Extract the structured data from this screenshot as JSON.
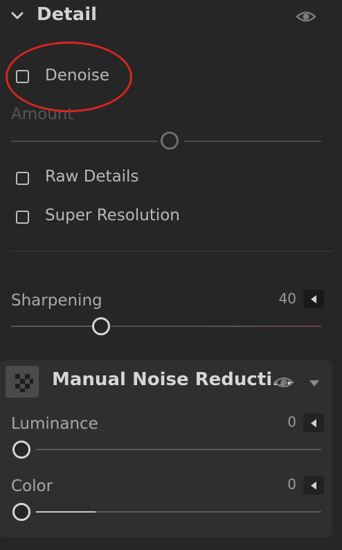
{
  "detail": {
    "title": "Detail",
    "chevron_icon": "chevron-down-icon",
    "visibility_icon": "eye-icon",
    "checkboxes": [
      {
        "label": "Denoise",
        "checked": false
      },
      {
        "label": "Raw Details",
        "checked": false
      },
      {
        "label": "Super Resolution",
        "checked": false
      }
    ],
    "amount": {
      "label": "Amount",
      "value_fraction": 0.5,
      "enabled": false
    },
    "sharpening": {
      "label": "Sharpening",
      "value": "40"
    }
  },
  "noise_reduction": {
    "title": "Manual Noise Reducti...",
    "icon": "noise-pattern-icon",
    "visibility_icon": "eye-icon",
    "dropdown_icon": "triangle-down-icon",
    "luminance": {
      "label": "Luminance",
      "value": "0"
    },
    "color": {
      "label": "Color",
      "value": "0"
    }
  },
  "annotation": {
    "color": "#d8261f",
    "shape": "red-ellipse-around-denoise"
  },
  "colors": {
    "background": "#262626",
    "subpanel": "#2f2f2f",
    "track_accent": "#7a3535"
  }
}
